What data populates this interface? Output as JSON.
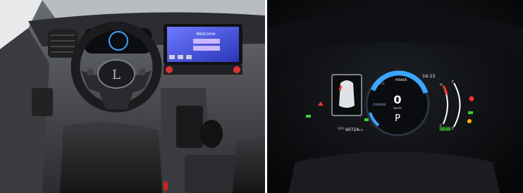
{
  "left_photo": {
    "screen_title": "Welcome",
    "steering_badge": "Lexus emblem"
  },
  "cluster": {
    "time": "16:15",
    "speed": "0",
    "speed_unit": "km/h",
    "gear": "P",
    "odometer": "60724",
    "odometer_unit": "km",
    "range_prefix": "ODO",
    "ready": "READY",
    "fuel_scale_top": "F",
    "fuel_scale_bottom": "E",
    "temp_scale_top": "H",
    "temp_scale_bottom": "C",
    "power_labels": [
      "POWER",
      "ECO",
      "CHARGE"
    ],
    "accent_color": "#3aa6ff",
    "warn_color": "#ff3030"
  }
}
